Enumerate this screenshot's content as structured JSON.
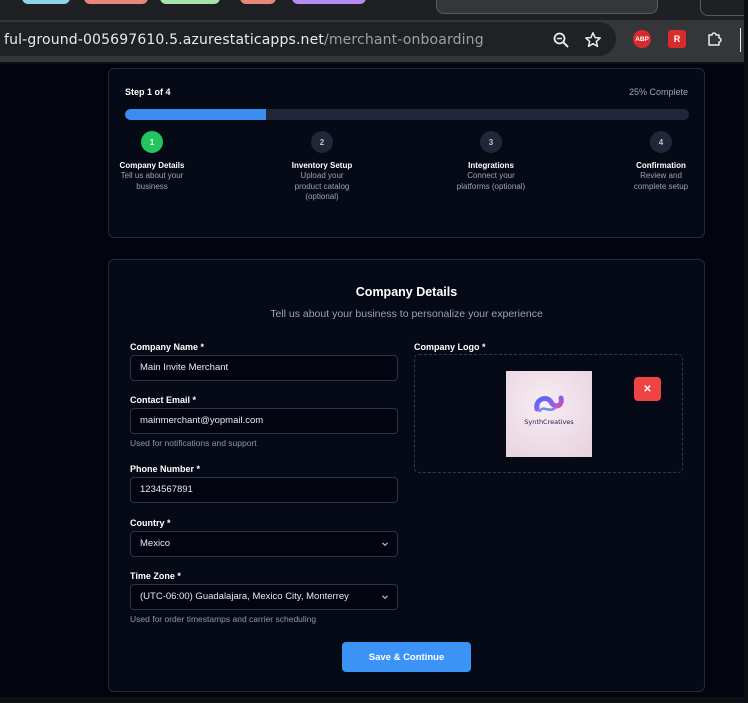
{
  "browser": {
    "url_host": "ful-ground-005697610.5.azurestaticapps.net",
    "url_path": "/merchant-onboarding",
    "extensions": [
      {
        "name": "adblock-plus-icon",
        "label": "ABP",
        "color": "#d82c2c"
      },
      {
        "name": "red-extension-icon",
        "label": "R",
        "color": "#d82c2c"
      }
    ]
  },
  "progress": {
    "step_of": "Step 1 of 4",
    "percent_label": "25% Complete",
    "percent": 25,
    "steps": [
      {
        "number": "1",
        "title": "Company Details",
        "desc": "Tell us about your business",
        "active": true
      },
      {
        "number": "2",
        "title": "Inventory Setup",
        "desc": "Upload your product catalog (optional)",
        "active": false
      },
      {
        "number": "3",
        "title": "Integrations",
        "desc": "Connect your platforms (optional)",
        "active": false
      },
      {
        "number": "4",
        "title": "Confirmation",
        "desc": "Review and complete setup",
        "active": false
      }
    ]
  },
  "form": {
    "title": "Company Details",
    "subtitle": "Tell us about your business to personalize your experience",
    "company_name": {
      "label": "Company Name *",
      "value": "Main Invite Merchant"
    },
    "contact_email": {
      "label": "Contact Email *",
      "value": "mainmerchant@yopmail.com",
      "help": "Used for notifications and support"
    },
    "phone": {
      "label": "Phone Number *",
      "value": "1234567891"
    },
    "country": {
      "label": "Country *",
      "value": "Mexico"
    },
    "time_zone": {
      "label": "Time Zone *",
      "value": "(UTC-06:00) Guadalajara, Mexico City, Monterrey",
      "help": "Used for order timestamps and carrier scheduling"
    },
    "logo": {
      "label": "Company Logo *",
      "logo_text": "SynthCreatives",
      "remove_symbol": "✕"
    },
    "submit_label": "Save & Continue"
  },
  "colors": {
    "accent": "#3b8ef0",
    "success": "#22c55e",
    "danger": "#ef4444",
    "background": "#02050f"
  }
}
